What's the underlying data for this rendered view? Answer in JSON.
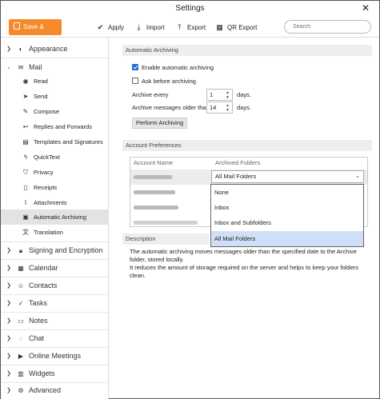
{
  "window": {
    "title": "Settings",
    "close_glyph": "✕"
  },
  "toolbar": {
    "save_close": "Save & Close",
    "apply": "Apply",
    "import": "Import",
    "export": "Export",
    "qr_export": "QR Export",
    "search_placeholder": "Search",
    "accent_color": "#f5892b"
  },
  "sidebar": {
    "groups": [
      {
        "label": "Appearance",
        "icon": "palette-icon",
        "expanded": false
      },
      {
        "label": "Mail",
        "icon": "envelope-icon",
        "expanded": true
      },
      {
        "label": "Signing and Encryption",
        "icon": "lock-icon",
        "expanded": false
      },
      {
        "label": "Calendar",
        "icon": "calendar-icon",
        "expanded": false
      },
      {
        "label": "Contacts",
        "icon": "person-icon",
        "expanded": false
      },
      {
        "label": "Tasks",
        "icon": "check-icon",
        "expanded": false
      },
      {
        "label": "Notes",
        "icon": "note-icon",
        "expanded": false
      },
      {
        "label": "Chat",
        "icon": "chat-icon",
        "expanded": false
      },
      {
        "label": "Online Meetings",
        "icon": "video-icon",
        "expanded": false
      },
      {
        "label": "Widgets",
        "icon": "widgets-icon",
        "expanded": false
      },
      {
        "label": "Advanced",
        "icon": "gear-icon",
        "expanded": false
      }
    ],
    "mail_items": [
      {
        "label": "Read",
        "icon": "eye-icon"
      },
      {
        "label": "Send",
        "icon": "send-icon"
      },
      {
        "label": "Compose",
        "icon": "pencil-icon"
      },
      {
        "label": "Replies and Forwards",
        "icon": "reply-icon"
      },
      {
        "label": "Templates and Signatures",
        "icon": "template-icon"
      },
      {
        "label": "QuickText",
        "icon": "lightning-icon"
      },
      {
        "label": "Privacy",
        "icon": "shield-icon"
      },
      {
        "label": "Receipts",
        "icon": "receipt-icon"
      },
      {
        "label": "Attachments",
        "icon": "paperclip-icon"
      },
      {
        "label": "Automatic Archiving",
        "icon": "archive-icon",
        "active": true
      },
      {
        "label": "Translation",
        "icon": "translate-icon"
      }
    ]
  },
  "archiving": {
    "header": "Automatic Archiving",
    "enable_label": "Enable automatic archiving",
    "enable_checked": true,
    "ask_label": "Ask before archiving",
    "ask_checked": false,
    "every_label": "Archive every",
    "every_value": "1",
    "every_unit": "days.",
    "older_label": "Archive messages older than",
    "older_value": "14",
    "older_unit": "days.",
    "perform_button": "Perform Archiving"
  },
  "account_prefs": {
    "header": "Account Preferences",
    "col_account": "Account Name",
    "col_folders": "Archived Folders",
    "selected_value": "All Mail Folders",
    "options": [
      "None",
      "Inbox",
      "Inbox and Subfolders",
      "All Mail Folders"
    ],
    "selected_index": 3
  },
  "description": {
    "header": "Description",
    "line1": "The automatic archiving moves messages older than the specified date to the Archive folder, stored locally.",
    "line2": "It reduces the amount of storage required on the server and helps to keep your folders clean."
  }
}
